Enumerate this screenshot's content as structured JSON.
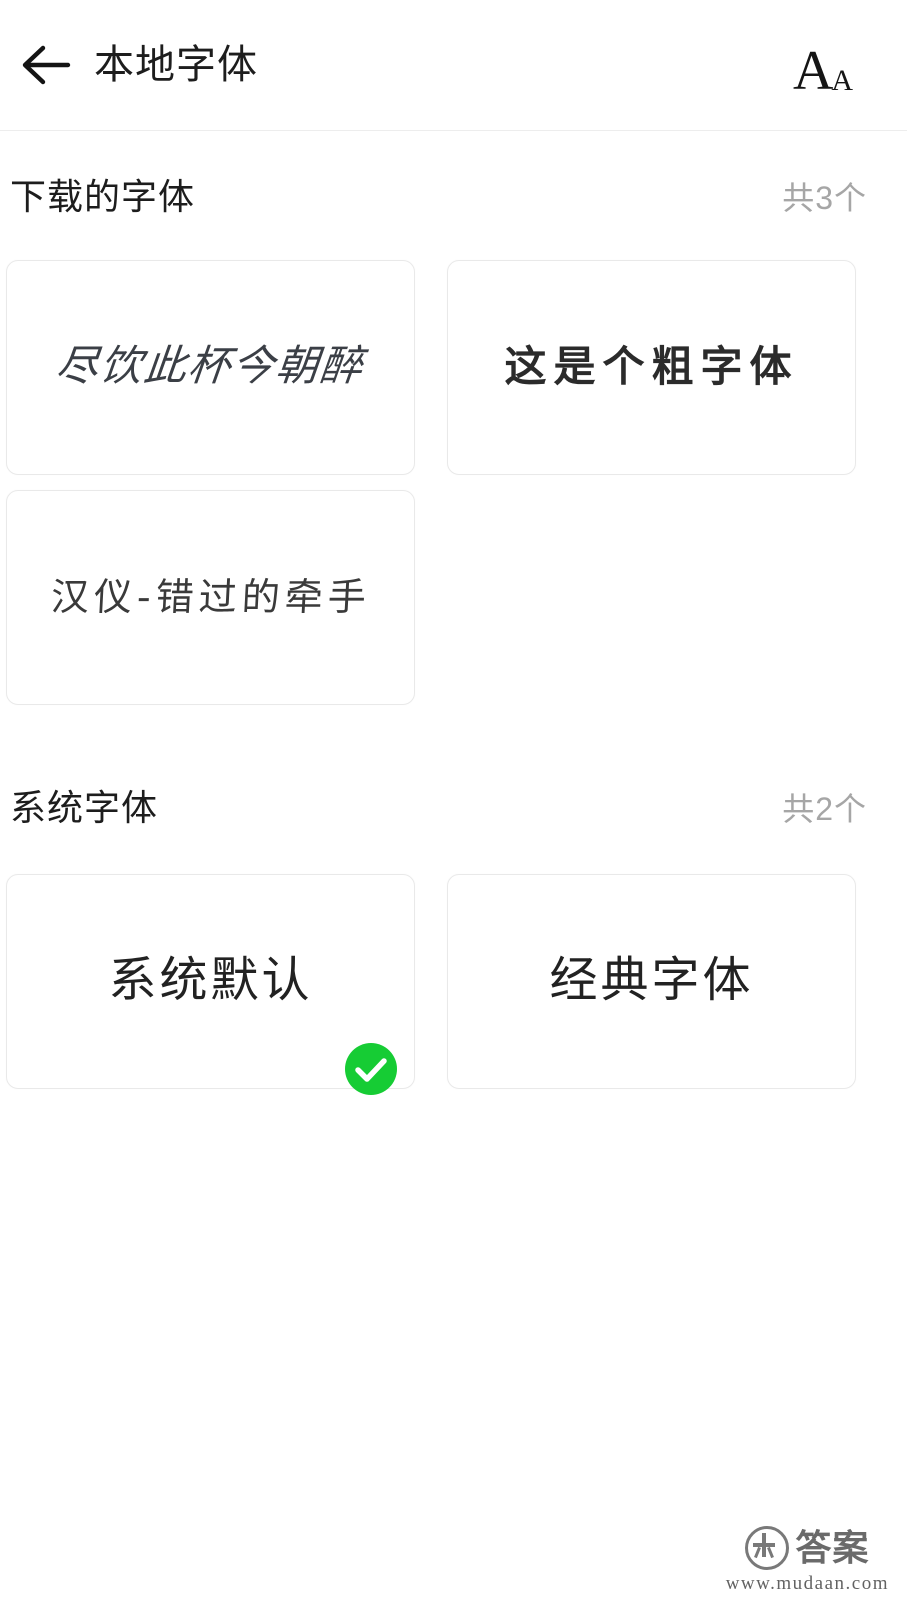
{
  "header": {
    "back_icon": "arrow-left-icon",
    "title": "本地字体",
    "font_size_icon_primary": "A",
    "font_size_icon_secondary": "A",
    "annotation": {
      "shape": "hand-drawn-circle",
      "color": "#e2342c"
    }
  },
  "sections": [
    {
      "id": "downloaded",
      "title": "下载的字体",
      "count_label": "共3个",
      "cards": [
        {
          "id": "card-1",
          "sample_text": "尽饮此杯今朝醉",
          "style": "s-script",
          "selected": false
        },
        {
          "id": "card-2",
          "sample_text": "这是个粗字体",
          "style": "s-bold",
          "selected": false
        },
        {
          "id": "card-3",
          "sample_text": "汉仪-错过的牵手",
          "style": "s-hand",
          "selected": false
        }
      ]
    },
    {
      "id": "system",
      "title": "系统字体",
      "count_label": "共2个",
      "cards": [
        {
          "id": "card-4",
          "sample_text": "系统默认",
          "style": "s-default",
          "selected": true
        },
        {
          "id": "card-5",
          "sample_text": "经典字体",
          "style": "s-classic",
          "selected": false
        }
      ]
    }
  ],
  "selected_badge": {
    "icon": "check-circle-icon",
    "color": "#16cc34"
  },
  "watermark": {
    "logo_glyph": "木",
    "brand": "答案",
    "url": "www.mudaan.com"
  }
}
